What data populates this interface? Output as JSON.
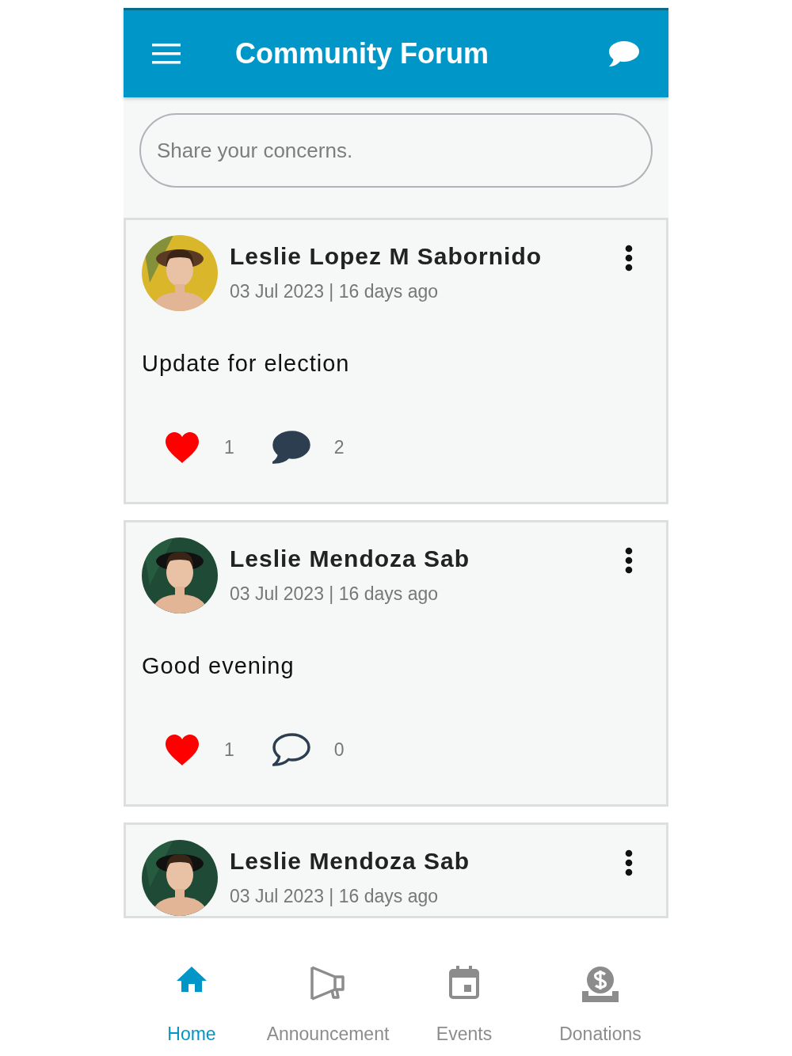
{
  "header": {
    "title": "Community Forum"
  },
  "composer": {
    "placeholder": "Share your concerns."
  },
  "posts": [
    {
      "author": "Leslie Lopez M Sabornido",
      "date": "03 Jul 2023 | 16 days ago",
      "body": "Update for election",
      "liked": true,
      "likes": "1",
      "commented": true,
      "comments": "2"
    },
    {
      "author": "Leslie Mendoza Sab",
      "date": "03 Jul 2023 | 16 days ago",
      "body": "Good evening",
      "liked": true,
      "likes": "1",
      "commented": false,
      "comments": "0"
    },
    {
      "author": "Leslie Mendoza Sab",
      "date": "03 Jul 2023 | 16 days ago"
    }
  ],
  "nav": [
    {
      "kind": "home",
      "label": "Home",
      "selected": true
    },
    {
      "kind": "announcement",
      "label": "Announcement",
      "selected": false
    },
    {
      "kind": "events",
      "label": "Events",
      "selected": false
    },
    {
      "kind": "donations",
      "label": "Donations",
      "selected": false
    }
  ]
}
